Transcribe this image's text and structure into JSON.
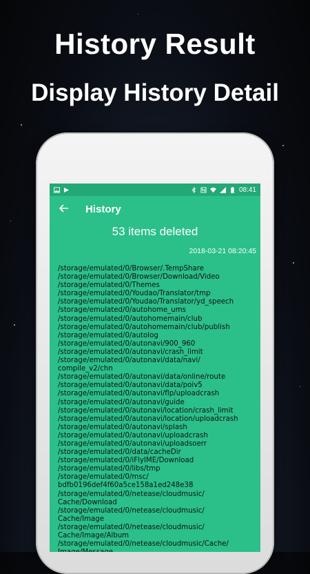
{
  "promo": {
    "title": "History Result",
    "subtitle": "Display History Detail"
  },
  "status_bar": {
    "time": "08:41",
    "left_icons": [
      "image-icon",
      "play-store-icon"
    ],
    "right_icons": [
      "bluetooth-icon",
      "nfc-icon",
      "wifi-icon",
      "signal-icon",
      "battery-icon"
    ]
  },
  "app_bar": {
    "back_icon": "arrow-left-icon",
    "title": "History"
  },
  "summary": {
    "count_text": "53 items deleted",
    "timestamp": "2018-03-21 08:20:45"
  },
  "paths": [
    "/storage/emulated/0/Browser/.TempShare",
    "/storage/emulated/0/Browser/Download/Video",
    "/storage/emulated/0/Themes",
    "/storage/emulated/0/Youdao/Translator/tmp",
    "/storage/emulated/0/Youdao/Translator/yd_speech",
    "/storage/emulated/0/autohome_ums",
    "/storage/emulated/0/autohomemain/club",
    "/storage/emulated/0/autohomemain/club/publish",
    "/storage/emulated/0/autolog",
    "/storage/emulated/0/autonavi/900_960",
    "/storage/emulated/0/autonavi/crash_limit",
    "/storage/emulated/0/autonavi/data/navi/",
    "compile_v2/chn",
    "/storage/emulated/0/autonavi/data/online/route",
    "/storage/emulated/0/autonavi/data/poiv5",
    "/storage/emulated/0/autonavi/flp/uploadcrash",
    "/storage/emulated/0/autonavi/guide",
    "/storage/emulated/0/autonavi/location/crash_limit",
    "/storage/emulated/0/autonavi/location/uploadcrash",
    "/storage/emulated/0/autonavi/splash",
    "/storage/emulated/0/autonavi/uploadcrash",
    "/storage/emulated/0/autonavi/uploadsoerr",
    "/storage/emulated/0/data/cacheDir",
    "/storage/emulated/0/iFlyIME/Download",
    "/storage/emulated/0/libs/tmp",
    "/storage/emulated/0/msc/",
    "bdfb0196def4f60a5ce158a1ed248e38",
    "/storage/emulated/0/netease/cloudmusic/",
    "Cache/Download",
    "/storage/emulated/0/netease/cloudmusic/",
    "Cache/Image",
    "/storage/emulated/0/netease/cloudmusic/",
    "Cache/Image/Album",
    "/storage/emulated/0/netease/cloudmusic/Cache/",
    "Image/Message"
  ],
  "colors": {
    "screen_bg": "#2bbf8a",
    "status_bg": "#23a877",
    "list_text": "#111111"
  }
}
